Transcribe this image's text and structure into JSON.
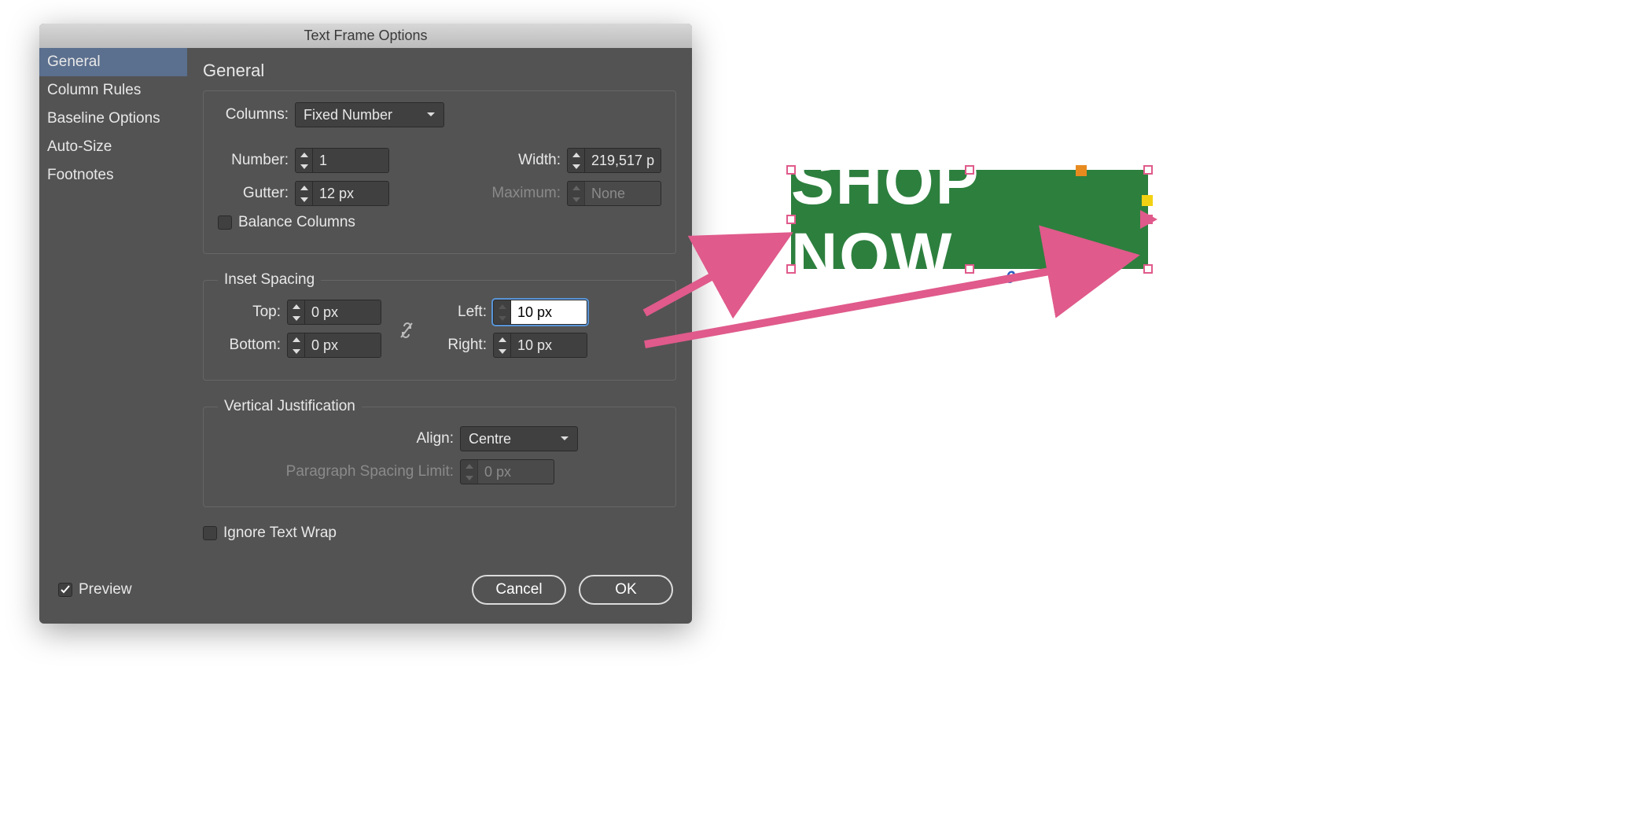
{
  "dialog": {
    "title": "Text Frame Options",
    "sidebar": {
      "items": [
        {
          "label": "General",
          "active": true
        },
        {
          "label": "Column Rules"
        },
        {
          "label": "Baseline Options"
        },
        {
          "label": "Auto-Size"
        },
        {
          "label": "Footnotes"
        }
      ]
    },
    "heading": "General",
    "columns_group": {
      "columns_label": "Columns:",
      "columns_mode": "Fixed Number",
      "number_label": "Number:",
      "number": "1",
      "gutter_label": "Gutter:",
      "gutter": "12 px",
      "width_label": "Width:",
      "width": "219,517 p",
      "maximum_label": "Maximum:",
      "maximum": "None",
      "balance_label": "Balance Columns",
      "balance_checked": false
    },
    "inset_group": {
      "legend": "Inset Spacing",
      "top_label": "Top:",
      "top": "0 px",
      "bottom_label": "Bottom:",
      "bottom": "0 px",
      "left_label": "Left:",
      "left": "10 px",
      "right_label": "Right:",
      "right": "10 px"
    },
    "vjust_group": {
      "legend": "Vertical Justification",
      "align_label": "Align:",
      "align_value": "Centre",
      "psl_label": "Paragraph Spacing Limit:",
      "psl_value": "0 px"
    },
    "ignore_text_wrap": {
      "label": "Ignore Text Wrap",
      "checked": false
    },
    "footer": {
      "preview_label": "Preview",
      "preview_checked": true,
      "cancel": "Cancel",
      "ok": "OK"
    }
  },
  "canvas": {
    "text": "SHOP NOW",
    "badge": "0"
  },
  "colors": {
    "accent_arrow": "#e05a8b",
    "green": "#2d7f3e"
  }
}
